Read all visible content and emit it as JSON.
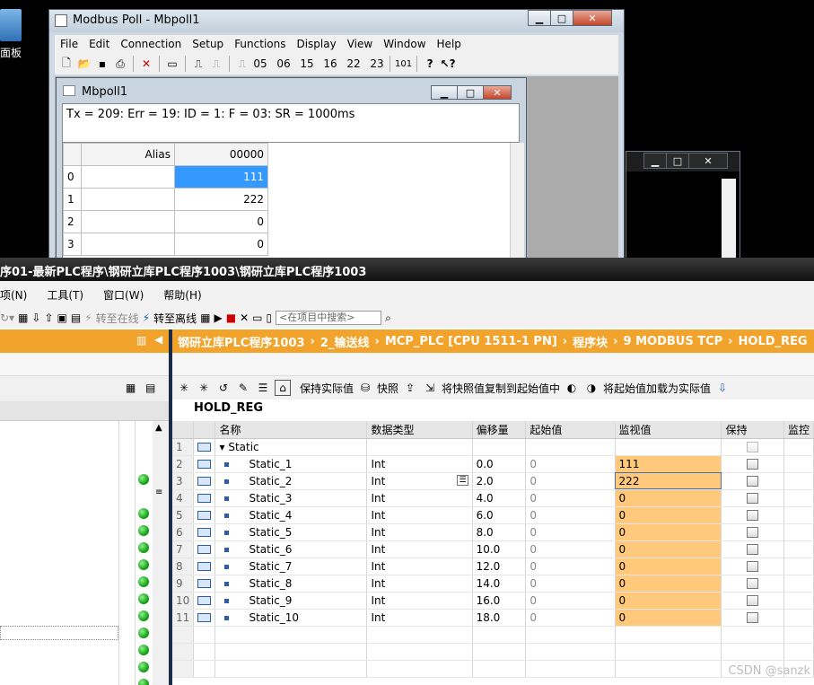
{
  "desktop": {
    "icon_label": "面板"
  },
  "modbus": {
    "title": "Modbus Poll - Mbpoll1",
    "menu": [
      "File",
      "Edit",
      "Connection",
      "Setup",
      "Functions",
      "Display",
      "View",
      "Window",
      "Help"
    ],
    "toolbar_codes": [
      "05",
      "06",
      "15",
      "16",
      "22",
      "23",
      "101"
    ],
    "child": {
      "title": "Mbpoll1",
      "status": "Tx = 209: Err = 19: ID = 1: F = 03: SR = 1000ms",
      "col_alias": "Alias",
      "col_addr": "00000",
      "rows": [
        {
          "idx": "0",
          "value": "111"
        },
        {
          "idx": "1",
          "value": "222"
        },
        {
          "idx": "2",
          "value": "0"
        },
        {
          "idx": "3",
          "value": "0"
        }
      ]
    }
  },
  "tia": {
    "title": "序01-最新PLC程序\\钢研立库PLC程序1003\\钢研立库PLC程序1003",
    "menu": [
      "项(N)",
      "工具(T)",
      "窗口(W)",
      "帮助(H)"
    ],
    "toolbar": {
      "go_offline": "转至在线",
      "go_online": "转至离线",
      "search_placeholder": "<在项目中搜索>"
    },
    "breadcrumb": [
      "钢研立库PLC程序1003",
      "2_输送线",
      "MCP_PLC [CPU 1511-1 PN]",
      "程序块",
      "9 MODBUS TCP",
      "HOLD_REG"
    ],
    "block_toolbar": {
      "keep_actual": "保持实际值",
      "snapshot": "快照",
      "copy_snapshot": "将快照值复制到起始值中",
      "load_start": "将起始值加载为实际值"
    },
    "block_name": "HOLD_REG",
    "columns": [
      "名称",
      "数据类型",
      "偏移量",
      "起始值",
      "监视值",
      "保持",
      "监控"
    ],
    "group": {
      "num": "1",
      "name": "Static"
    },
    "rows": [
      {
        "num": "2",
        "name": "Static_1",
        "type": "Int",
        "offset": "0.0",
        "start": "0",
        "monitor": "111"
      },
      {
        "num": "3",
        "name": "Static_2",
        "type": "Int",
        "offset": "2.0",
        "start": "0",
        "monitor": "222"
      },
      {
        "num": "4",
        "name": "Static_3",
        "type": "Int",
        "offset": "4.0",
        "start": "0",
        "monitor": "0"
      },
      {
        "num": "5",
        "name": "Static_4",
        "type": "Int",
        "offset": "6.0",
        "start": "0",
        "monitor": "0"
      },
      {
        "num": "6",
        "name": "Static_5",
        "type": "Int",
        "offset": "8.0",
        "start": "0",
        "monitor": "0"
      },
      {
        "num": "7",
        "name": "Static_6",
        "type": "Int",
        "offset": "10.0",
        "start": "0",
        "monitor": "0"
      },
      {
        "num": "8",
        "name": "Static_7",
        "type": "Int",
        "offset": "12.0",
        "start": "0",
        "monitor": "0"
      },
      {
        "num": "9",
        "name": "Static_8",
        "type": "Int",
        "offset": "14.0",
        "start": "0",
        "monitor": "0"
      },
      {
        "num": "10",
        "name": "Static_9",
        "type": "Int",
        "offset": "16.0",
        "start": "0",
        "monitor": "0"
      },
      {
        "num": "11",
        "name": "Static_10",
        "type": "Int",
        "offset": "18.0",
        "start": "0",
        "monitor": "0"
      }
    ]
  },
  "watermark": "CSDN @sanzk"
}
